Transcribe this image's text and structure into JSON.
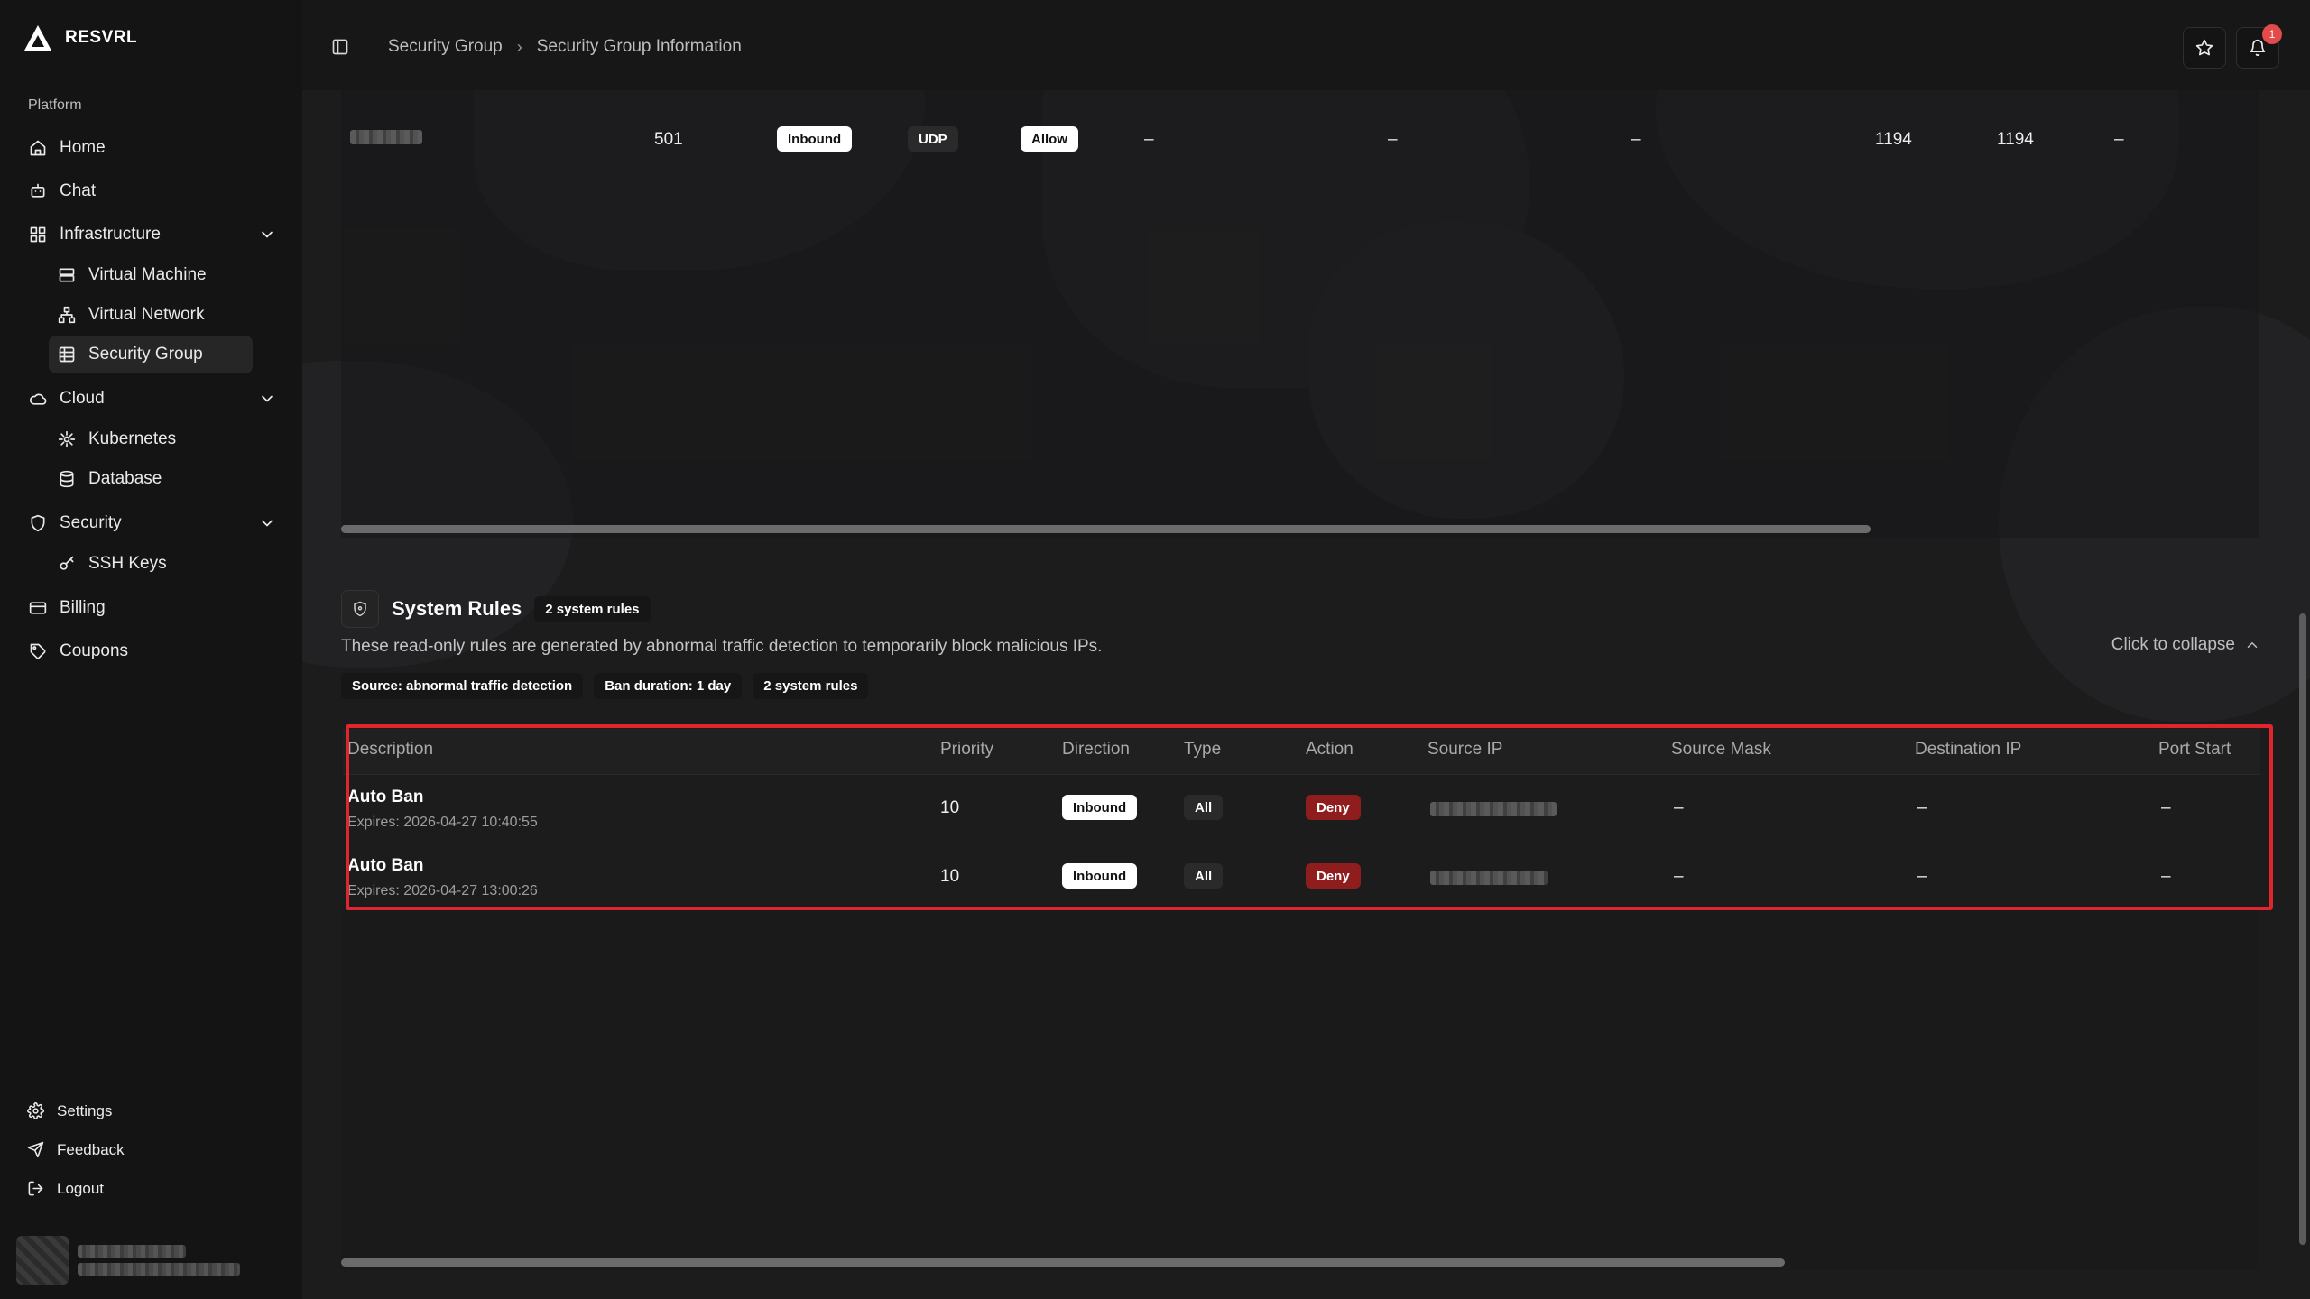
{
  "app": {
    "name": "RESVRL"
  },
  "sidebar": {
    "group_label": "Platform",
    "items": [
      {
        "label": "Home",
        "icon": "home-icon"
      },
      {
        "label": "Chat",
        "icon": "chat-icon"
      },
      {
        "label": "Infrastructure",
        "icon": "infrastructure-icon",
        "expanded": true,
        "children": [
          {
            "label": "Virtual Machine",
            "icon": "server-icon"
          },
          {
            "label": "Virtual Network",
            "icon": "network-icon"
          },
          {
            "label": "Security Group",
            "icon": "table-icon",
            "active": true
          }
        ]
      },
      {
        "label": "Cloud",
        "icon": "cloud-icon",
        "expanded": true,
        "children": [
          {
            "label": "Kubernetes",
            "icon": "kubernetes-icon"
          },
          {
            "label": "Database",
            "icon": "database-icon"
          }
        ]
      },
      {
        "label": "Security",
        "icon": "shield-icon",
        "expanded": true,
        "children": [
          {
            "label": "SSH Keys",
            "icon": "key-icon"
          }
        ]
      },
      {
        "label": "Billing",
        "icon": "billing-icon"
      },
      {
        "label": "Coupons",
        "icon": "coupon-icon"
      }
    ],
    "bottom": [
      {
        "label": "Settings",
        "icon": "gear-icon"
      },
      {
        "label": "Feedback",
        "icon": "send-icon"
      },
      {
        "label": "Logout",
        "icon": "logout-icon"
      }
    ]
  },
  "header": {
    "breadcrumb": [
      "Security Group",
      "Security Group Information"
    ],
    "notification_count": "1"
  },
  "upper_rule": {
    "priority": "501",
    "direction": "Inbound",
    "type": "UDP",
    "action": "Allow",
    "source_ip": "–",
    "source_mask": "–",
    "destination_ip": "–",
    "port_start": "1194",
    "port_end": "1194",
    "last": "–"
  },
  "system_rules": {
    "title": "System Rules",
    "count_chip": "2 system rules",
    "description": "These read-only rules are generated by abnormal traffic detection to temporarily block malicious IPs.",
    "collapse_label": "Click to collapse",
    "chips": [
      "Source: abnormal traffic detection",
      "Ban duration: 1 day",
      "2 system rules"
    ],
    "columns": [
      "Description",
      "Priority",
      "Direction",
      "Type",
      "Action",
      "Source IP",
      "Source Mask",
      "Destination IP",
      "Port Start"
    ],
    "rows": [
      {
        "title": "Auto Ban",
        "expires": "Expires: 2026-04-27 10:40:55",
        "priority": "10",
        "direction": "Inbound",
        "type": "All",
        "action": "Deny",
        "source_mask": "–",
        "destination_ip": "–",
        "port_start": "–"
      },
      {
        "title": "Auto Ban",
        "expires": "Expires: 2026-04-27 13:00:26",
        "priority": "10",
        "direction": "Inbound",
        "type": "All",
        "action": "Deny",
        "source_mask": "–",
        "destination_ip": "–",
        "port_start": "–"
      }
    ]
  },
  "colors": {
    "accent_deny": "#8f1d1d",
    "highlight": "#e0252f",
    "background": "#1c1c1d"
  }
}
